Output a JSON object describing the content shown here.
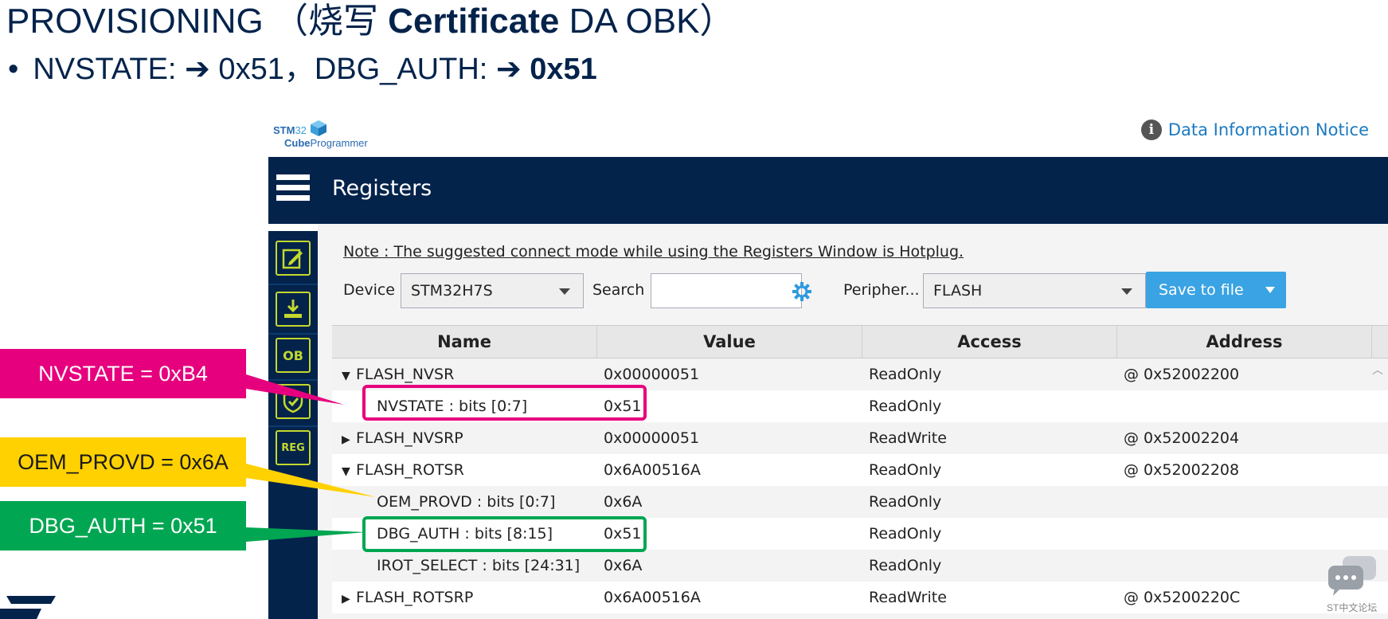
{
  "slide": {
    "title_prefix": "PROVISIONING （烧写 ",
    "title_bold": "Certificate",
    "title_suffix": " DA OBK）",
    "bullet_dot": "•",
    "bullet_text": "NVSTATE: ➔ 0x51，DBG_AUTH: ➔ ",
    "bullet_bold": "0x51"
  },
  "app": {
    "logo_stm": "STM",
    "logo_32": "32",
    "logo_cube": "Cube",
    "logo_programmer": "Programmer",
    "notice_icon": "i",
    "notice_text": "Data Information Notice",
    "window_title": "Registers",
    "note": "Note : The suggested connect mode while using the Registers Window is Hotplug.",
    "device_label": "Device :",
    "device_value": "STM32H7S",
    "search_label": "Search :",
    "search_value": "",
    "peripheral_label": "Peripher...",
    "peripheral_value": "FLASH",
    "save_label": "Save to file",
    "sidebar_icons": [
      "edit-icon",
      "download-icon",
      "ob-icon",
      "security-shield-icon",
      "reg-icon"
    ],
    "sidebar_ob_text": "OB",
    "sidebar_reg_text": "REG"
  },
  "table": {
    "columns": [
      "Name",
      "Value",
      "Access",
      "Address"
    ],
    "rows": [
      {
        "expander": "▼",
        "name": "FLASH_NVSR",
        "value": "0x00000051",
        "access": "ReadOnly",
        "address": "@ 0x52002200"
      },
      {
        "expander": "",
        "name": "NVSTATE : bits [0:7]",
        "value": "0x51",
        "access": "ReadOnly",
        "address": ""
      },
      {
        "expander": "▶",
        "name": "FLASH_NVSRP",
        "value": "0x00000051",
        "access": "ReadWrite",
        "address": "@ 0x52002204"
      },
      {
        "expander": "▼",
        "name": "FLASH_ROTSR",
        "value": "0x6A00516A",
        "access": "ReadOnly",
        "address": "@ 0x52002208"
      },
      {
        "expander": "",
        "name": "OEM_PROVD : bits [0:7]",
        "value": "0x6A",
        "access": "ReadOnly",
        "address": ""
      },
      {
        "expander": "",
        "name": "DBG_AUTH : bits [8:15]",
        "value": "0x51",
        "access": "ReadOnly",
        "address": ""
      },
      {
        "expander": "",
        "name": "IROT_SELECT : bits [24:31]",
        "value": "0x6A",
        "access": "ReadOnly",
        "address": ""
      },
      {
        "expander": "▶",
        "name": "FLASH_ROTSRP",
        "value": "0x6A00516A",
        "access": "ReadWrite",
        "address": "@ 0x5200220C"
      }
    ]
  },
  "annotations": {
    "nvstate": "NVSTATE = 0xB4",
    "oem_provd": "OEM_PROVD = 0x6A",
    "dbg_auth": "DBG_AUTH = 0x51",
    "pink": "#e6007e",
    "yellow": "#ffd100",
    "green": "#00a651"
  },
  "watermark": {
    "forum_text": "ST中文论坛"
  }
}
